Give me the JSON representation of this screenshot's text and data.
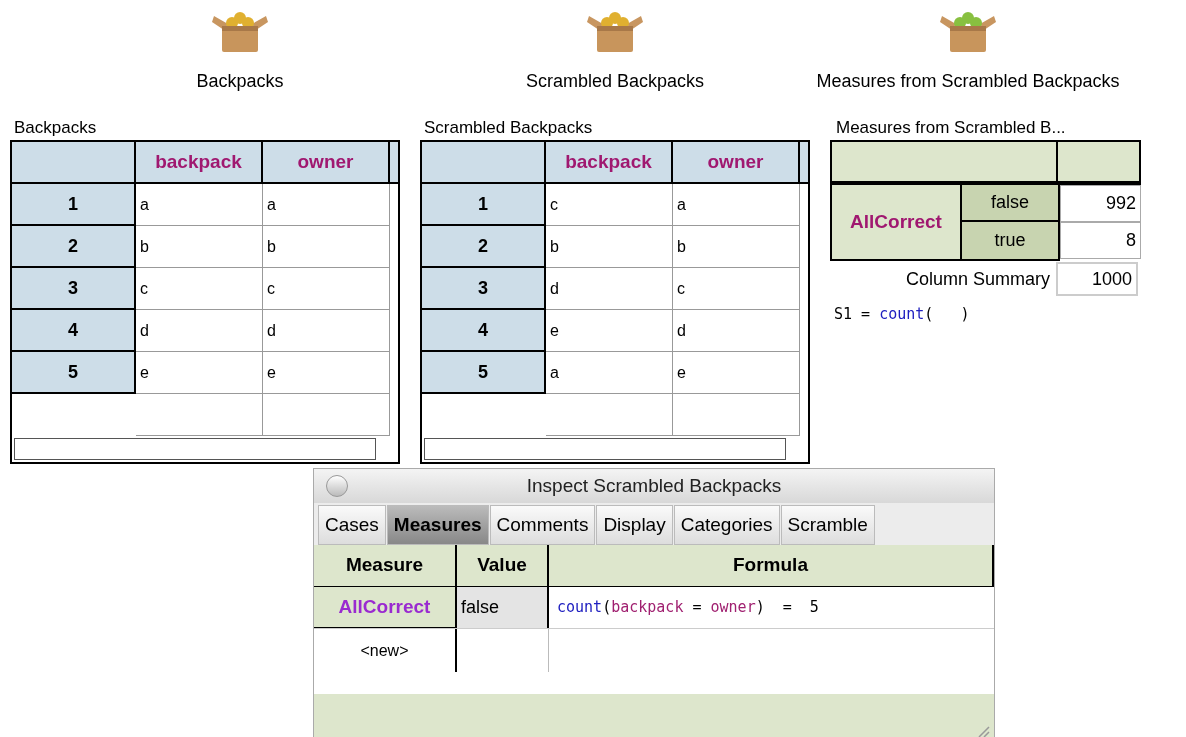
{
  "icons": [
    {
      "label": "Backpacks",
      "color": "#e0b030"
    },
    {
      "label": "Scrambled Backpacks",
      "color": "#e0b030"
    },
    {
      "label": "Measures from Scrambled Backpacks",
      "color": "#88c040"
    }
  ],
  "tables": [
    {
      "title": "Backpacks",
      "columns": [
        "backpack",
        "owner"
      ],
      "rows": [
        {
          "index": "1",
          "cells": [
            "a",
            "a"
          ]
        },
        {
          "index": "2",
          "cells": [
            "b",
            "b"
          ]
        },
        {
          "index": "3",
          "cells": [
            "c",
            "c"
          ]
        },
        {
          "index": "4",
          "cells": [
            "d",
            "d"
          ]
        },
        {
          "index": "5",
          "cells": [
            "e",
            "e"
          ]
        }
      ]
    },
    {
      "title": "Scrambled Backpacks",
      "columns": [
        "backpack",
        "owner"
      ],
      "rows": [
        {
          "index": "1",
          "cells": [
            "c",
            "a"
          ]
        },
        {
          "index": "2",
          "cells": [
            "b",
            "b"
          ]
        },
        {
          "index": "3",
          "cells": [
            "d",
            "c"
          ]
        },
        {
          "index": "4",
          "cells": [
            "e",
            "d"
          ]
        },
        {
          "index": "5",
          "cells": [
            "a",
            "e"
          ]
        }
      ]
    }
  ],
  "summary_table": {
    "title": "Measures from Scrambled B...",
    "attribute": "AllCorrect",
    "rows": [
      {
        "category": "false",
        "count": "992"
      },
      {
        "category": "true",
        "count": "8"
      }
    ],
    "column_summary_label": "Column Summary",
    "column_summary": "1000",
    "formula": [
      {
        "kind": "text",
        "text": "S1 = "
      },
      {
        "kind": "function",
        "text": "count"
      },
      {
        "kind": "text",
        "text": "(   )"
      }
    ]
  },
  "inspector": {
    "title": "Inspect Scrambled Backpacks",
    "tabs": [
      {
        "label": "Cases",
        "selected": false
      },
      {
        "label": "Measures",
        "selected": true
      },
      {
        "label": "Comments",
        "selected": false
      },
      {
        "label": "Display",
        "selected": false
      },
      {
        "label": "Categories",
        "selected": false
      },
      {
        "label": "Scramble",
        "selected": false
      }
    ],
    "columns": [
      "Measure",
      "Value",
      "Formula"
    ],
    "rows": [
      {
        "measure": "AllCorrect",
        "value": "false",
        "formula": [
          {
            "kind": "function",
            "text": "count"
          },
          {
            "kind": "text",
            "text": "("
          },
          {
            "kind": "attribute",
            "text": "backpack"
          },
          {
            "kind": "text",
            "text": " = "
          },
          {
            "kind": "attribute",
            "text": "owner"
          },
          {
            "kind": "text",
            "text": ")  =  5"
          }
        ]
      }
    ],
    "new_row": "<new>"
  }
}
